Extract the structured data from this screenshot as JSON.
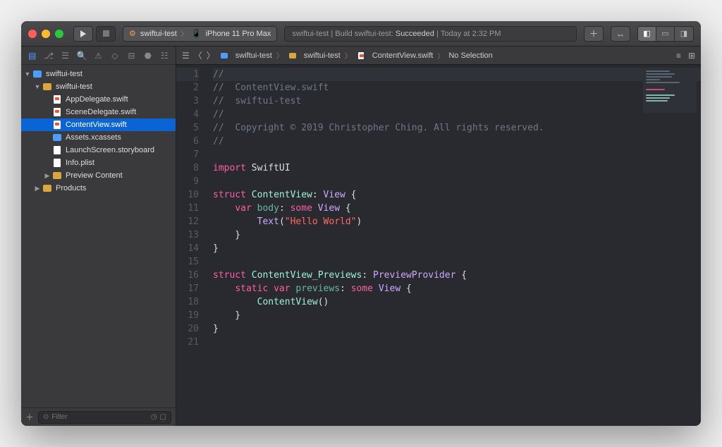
{
  "titlebar": {
    "scheme_target": "swiftui-test",
    "scheme_device": "iPhone 11 Pro Max",
    "status_project": "swiftui-test",
    "status_action": "Build swiftui-test:",
    "status_result": "Succeeded",
    "status_time": "Today at 2:32 PM"
  },
  "sidebar": {
    "root": "swiftui-test",
    "group": "swiftui-test",
    "files": {
      "app_delegate": "AppDelegate.swift",
      "scene_delegate": "SceneDelegate.swift",
      "content_view": "ContentView.swift",
      "assets": "Assets.xcassets",
      "launch": "LaunchScreen.storyboard",
      "info": "Info.plist",
      "preview": "Preview Content",
      "products": "Products"
    },
    "filter_placeholder": "Filter"
  },
  "jumpbar": {
    "p1": "swiftui-test",
    "p2": "swiftui-test",
    "p3": "ContentView.swift",
    "p4": "No Selection"
  },
  "code": {
    "lines": [
      "1",
      "2",
      "3",
      "4",
      "5",
      "6",
      "7",
      "8",
      "9",
      "10",
      "11",
      "12",
      "13",
      "14",
      "15",
      "16",
      "17",
      "18",
      "19",
      "20",
      "21"
    ],
    "l1": "//",
    "l2a": "//  ",
    "l2b": "ContentView.swift",
    "l3a": "//  ",
    "l3b": "swiftui-test",
    "l4": "//",
    "l5a": "//  ",
    "l5b": "Copyright © 2019 Christopher Ching. All rights reserved.",
    "l6": "//",
    "l8a": "import",
    "l8b": " SwiftUI",
    "l10a": "struct",
    "l10b": " ContentView",
    "l10c": ": ",
    "l10d": "View",
    "l10e": " {",
    "l11a": "    ",
    "l11b": "var",
    "l11c": " body",
    "l11d": ": ",
    "l11e": "some",
    "l11f": " View",
    "l11g": " {",
    "l12a": "        ",
    "l12b": "Text",
    "l12c": "(",
    "l12d": "\"Hello World\"",
    "l12e": ")",
    "l13": "    }",
    "l14": "}",
    "l16a": "struct",
    "l16b": " ContentView_Previews",
    "l16c": ": ",
    "l16d": "PreviewProvider",
    "l16e": " {",
    "l17a": "    ",
    "l17b": "static",
    "l17c": " ",
    "l17d": "var",
    "l17e": " previews",
    "l17f": ": ",
    "l17g": "some",
    "l17h": " View",
    "l17i": " {",
    "l18a": "        ",
    "l18b": "ContentView",
    "l18c": "()",
    "l19": "    }",
    "l20": "}"
  }
}
